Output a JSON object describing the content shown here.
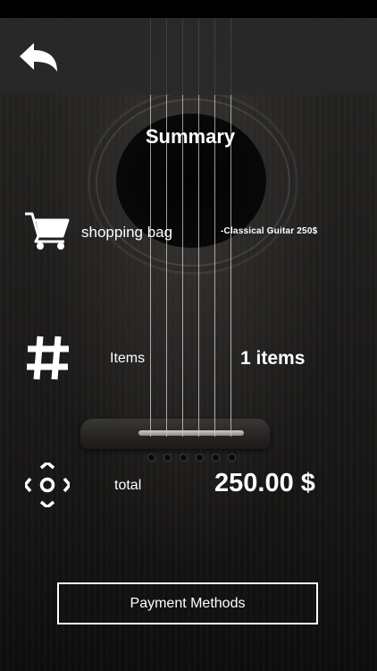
{
  "screen": {
    "title": "Summary"
  },
  "header": {
    "back_icon": "back-arrow-icon"
  },
  "summary": {
    "bag": {
      "icon": "shopping-cart-icon",
      "label": "shopping bag",
      "item": "-Classical Guitar 250$"
    },
    "items": {
      "icon": "hash-icon",
      "label": "Items",
      "value": "1 items"
    },
    "total": {
      "icon": "target-icon",
      "label": "total",
      "value": "250.00 $"
    }
  },
  "actions": {
    "payment_label": "Payment Methods"
  },
  "colors": {
    "text": "#ffffff",
    "header_bg": "#282828",
    "background": "#1e1d1c"
  }
}
